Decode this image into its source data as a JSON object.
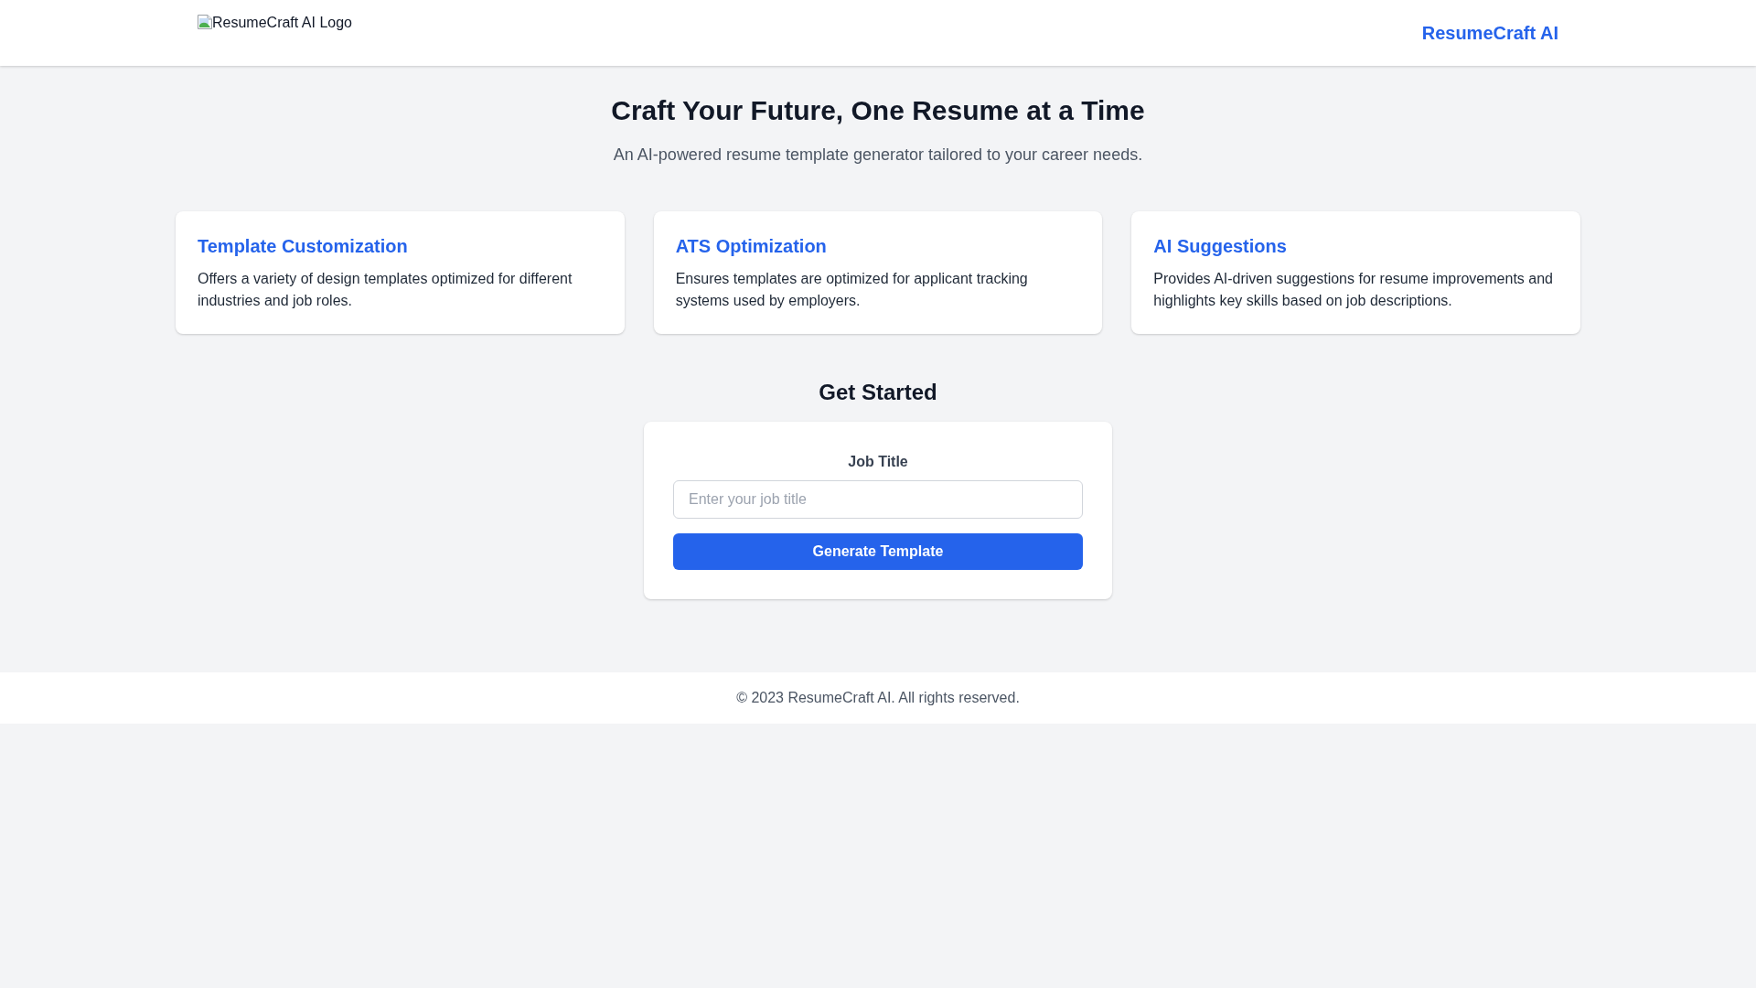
{
  "header": {
    "logo_alt": "ResumeCraft AI Logo",
    "brand": "ResumeCraft AI"
  },
  "hero": {
    "title": "Craft Your Future, One Resume at a Time",
    "subtitle": "An AI-powered resume template generator tailored to your career needs."
  },
  "features": [
    {
      "title": "Template Customization",
      "description": "Offers a variety of design templates optimized for different industries and job roles."
    },
    {
      "title": "ATS Optimization",
      "description": "Ensures templates are optimized for applicant tracking systems used by employers."
    },
    {
      "title": "AI Suggestions",
      "description": "Provides AI-driven suggestions for resume improvements and highlights key skills based on job descriptions."
    }
  ],
  "get_started": {
    "title": "Get Started",
    "field": {
      "label": "Job Title",
      "placeholder": "Enter your job title"
    },
    "button": "Generate Template"
  },
  "footer": {
    "text": "© 2023 ResumeCraft AI. All rights reserved."
  }
}
